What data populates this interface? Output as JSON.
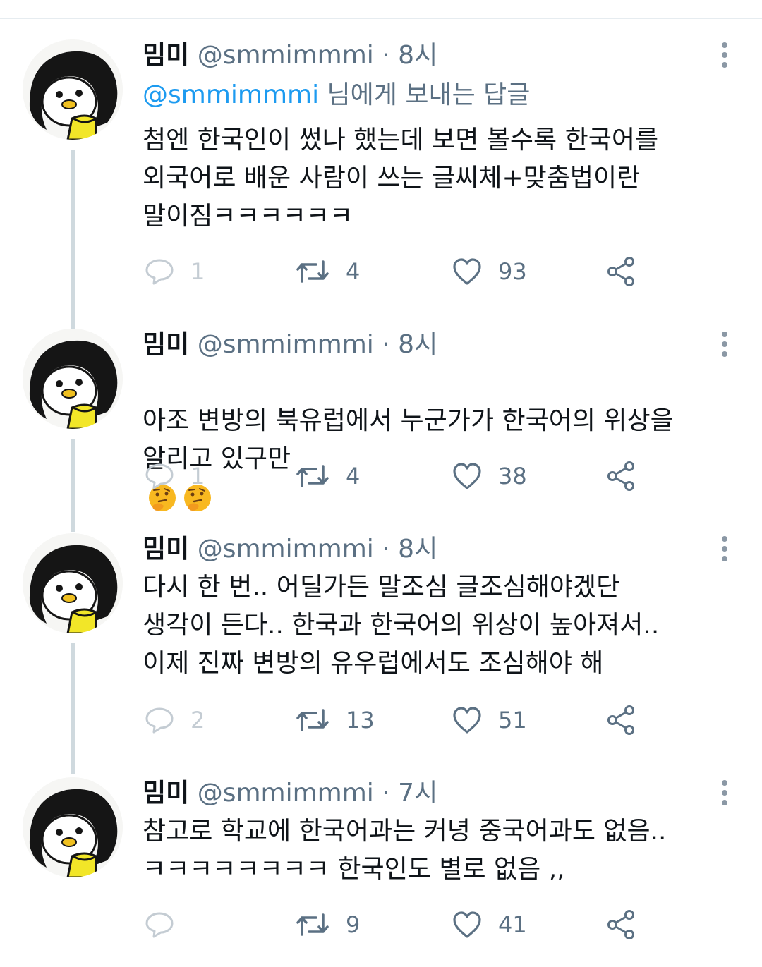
{
  "tweets": [
    {
      "name": "밈미",
      "handle": "@smmimmmi",
      "dot": "·",
      "time": "8시",
      "replying_mention": "@smmimmmi",
      "replying_suffix": " 님에게 보내는 답글",
      "text": "첨엔 한국인이 썼나 했는데 보면 볼수록 한국어를\n외국어로 배운 사람이 쓰는 글씨체+맞춤법이란\n말이짐ㅋㅋㅋㅋㅋㅋ",
      "replies": "1",
      "retweets": "4",
      "likes": "93"
    },
    {
      "name": "밈미",
      "handle": "@smmimmmi",
      "dot": "·",
      "time": "8시",
      "text": "아조 변방의 북유럽에서 누군가가 한국어의 위상을\n알리고 있구만",
      "emojis": [
        "thinking-face",
        "thinking-face"
      ],
      "replies": "1",
      "retweets": "4",
      "likes": "38"
    },
    {
      "name": "밈미",
      "handle": "@smmimmmi",
      "dot": "·",
      "time": "8시",
      "text": "다시 한 번.. 어딜가든 말조심 글조심해야겠단\n생각이 든다.. 한국과 한국어의 위상이 높아져서..\n이제 진짜 변방의 유우럽에서도 조심해야 해",
      "replies": "2",
      "retweets": "13",
      "likes": "51"
    },
    {
      "name": "밈미",
      "handle": "@smmimmmi",
      "dot": "·",
      "time": "7시",
      "text": "참고로 학교에 한국어과는 커녕 중국어과도 없음..\nㅋㅋㅋㅋㅋㅋㅋㅋ 한국인도 별로 없음 ,,",
      "replies": "",
      "retweets": "9",
      "likes": "41"
    }
  ],
  "colors": {
    "text": "#0f1419",
    "secondary": "#5b7083",
    "link": "#1d9bf0",
    "thread_line": "#cfd9de",
    "faint": "#c4ccd3"
  },
  "icons": {
    "reply": "speech-bubble-icon",
    "retweet": "retweet-icon",
    "like": "heart-icon",
    "share": "share-icon",
    "more": "more-vertical-icon"
  }
}
